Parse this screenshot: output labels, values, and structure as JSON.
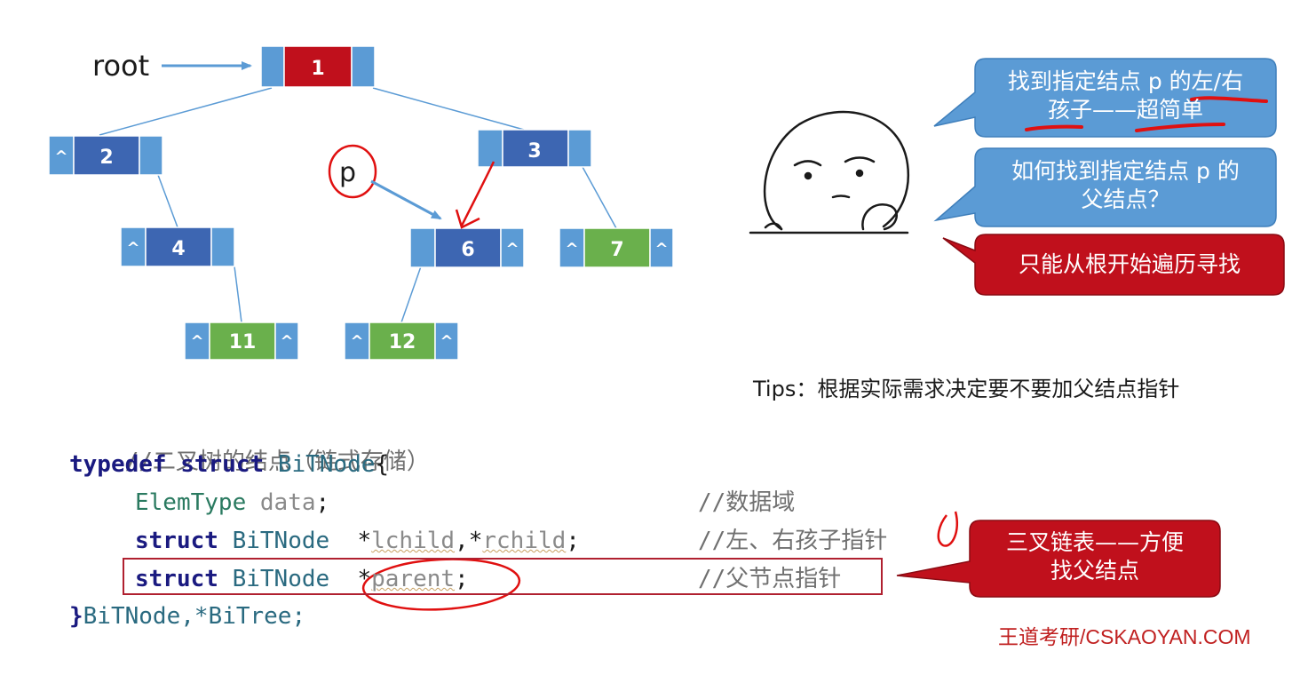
{
  "tree": {
    "root_label": "root",
    "pointer_label": "p",
    "null_marker": "^",
    "nodes": {
      "n1": "1",
      "n2": "2",
      "n3": "3",
      "n4": "4",
      "n6": "6",
      "n7": "7",
      "n11": "11",
      "n12": "12"
    }
  },
  "bubbles": {
    "easy": "找到指定结点 p 的左/右孩子——超简单",
    "easy_line1": "找到指定结点 p 的左/右",
    "easy_line2": "孩子——超简单",
    "question_line1": "如何找到指定结点 p 的",
    "question_line2": "父结点？",
    "answer": "只能从根开始遍历寻找",
    "trident_line1": "三叉链表——方便",
    "trident_line2": "找父结点"
  },
  "tips": "Tips：根据实际需求决定要不要加父结点指针",
  "code": {
    "comment": "//二叉树的结点（链式存储）",
    "kw_typedef": "typedef",
    "kw_struct": "struct",
    "type_name": "BiTNode",
    "brace_open": "{",
    "elemtype": "ElemType",
    "field_data": "data",
    "semicolon": ";",
    "comment_data": "//数据域",
    "star": "*",
    "field_lchild": "lchild",
    "comma": ",",
    "field_rchild": "rchild",
    "comment_children": "//左、右孩子指针",
    "field_parent": "parent",
    "comment_parent": "//父节点指针",
    "brace_close": "}",
    "typedef_names": "BiTNode,*BiTree;"
  },
  "watermark": "王道考研/CSKAOYAN.COM",
  "colors": {
    "root_node": "#c0101c",
    "node_dark": "#3d66b2",
    "node_light": "#5b9bd5",
    "leaf_green": "#6ab04c",
    "bubble_blue": "#5b9bd5",
    "bubble_red": "#c0101c",
    "annotation_red": "#e01010"
  }
}
